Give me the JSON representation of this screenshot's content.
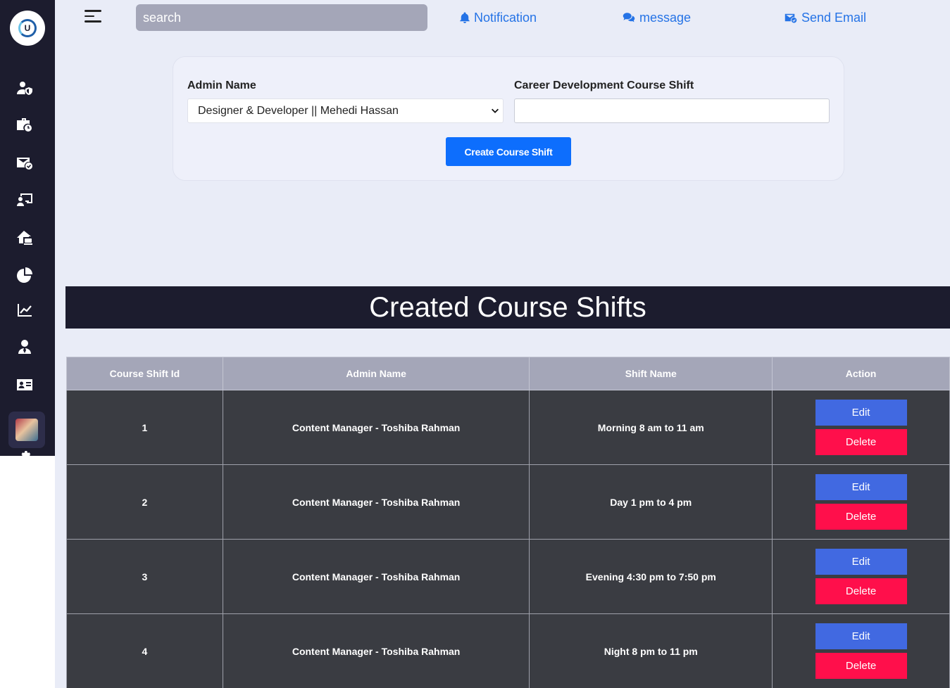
{
  "sidebar": {
    "logo_text": "U",
    "icons": [
      "user-shield-icon",
      "briefcase-clock-icon",
      "envelope-check-icon",
      "chalkboard-user-icon",
      "house-laptop-icon",
      "pie-chart-icon",
      "line-chart-icon",
      "user-tie-icon",
      "id-card-icon",
      "settings-icon"
    ]
  },
  "topbar": {
    "search_placeholder": "search",
    "notification": "Notification",
    "message": "message",
    "send_email": "Send Email",
    "link_color": "#2573e6"
  },
  "form": {
    "admin_label": "Admin Name",
    "admin_selected": "Designer & Developer || Mehedi Hassan",
    "shift_label": "Career Development Course Shift",
    "shift_value": "",
    "submit_label": "Create Course Shift"
  },
  "section": {
    "title": "Created Course Shifts"
  },
  "table": {
    "headers": [
      "Course Shift Id",
      "Admin Name",
      "Shift Name",
      "Action"
    ],
    "rows": [
      {
        "id": "1",
        "admin": "Content Manager - Toshiba Rahman",
        "shift": "Morning 8 am to 11 am",
        "edit": "Edit",
        "delete": "Delete"
      },
      {
        "id": "2",
        "admin": "Content Manager - Toshiba Rahman",
        "shift": "Day 1 pm to 4 pm",
        "edit": "Edit",
        "delete": "Delete"
      },
      {
        "id": "3",
        "admin": "Content Manager - Toshiba Rahman",
        "shift": "Evening 4:30 pm to 7:50 pm",
        "edit": "Edit",
        "delete": "Delete"
      },
      {
        "id": "4",
        "admin": "Content Manager - Toshiba Rahman",
        "shift": "Night 8 pm to 11 pm",
        "edit": "Edit",
        "delete": "Delete"
      }
    ]
  },
  "colors": {
    "primary": "#0d6efd",
    "edit": "#4169e1",
    "delete": "#ff0f4b",
    "dark": "#1c1c2e"
  }
}
